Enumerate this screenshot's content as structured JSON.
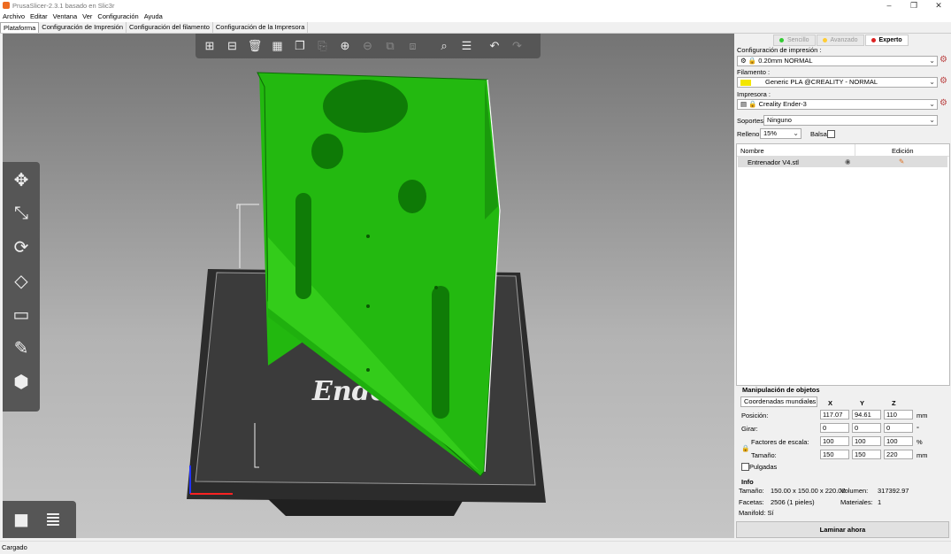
{
  "window": {
    "title": "PrusaSlicer-2.3.1 basado en Slic3r"
  },
  "menu": [
    "Archivo",
    "Editar",
    "Ventana",
    "Ver",
    "Configuración",
    "Ayuda"
  ],
  "tabs": [
    "Plataforma",
    "Configuración de Impresión",
    "Configuración del filamento",
    "Configuración de la Impresora"
  ],
  "toolbar_icons": [
    "add-icon",
    "delete-icon",
    "delete-all-icon",
    "arrange-icon",
    "copy-icon",
    "paste-icon",
    "add-instance-icon",
    "remove-instance-icon",
    "split-objects-icon",
    "split-parts-icon",
    "search-icon",
    "layers-editing-icon",
    "undo-icon",
    "redo-icon"
  ],
  "gizmo_icons": [
    "move-icon",
    "scale-icon",
    "rotate-icon",
    "place-on-face-icon",
    "cut-icon",
    "support-paint-icon",
    "seam-paint-icon"
  ],
  "view_buttons": [
    "3d-view-icon",
    "preview-layers-icon"
  ],
  "bed_label": "Ender",
  "mode": {
    "simple": "Sencillo",
    "advanced": "Avanzado",
    "expert": "Experto"
  },
  "print_settings": {
    "label": "Configuración de impresión :",
    "value": "0.20mm NORMAL"
  },
  "filament": {
    "label": "Filamento :",
    "value": "Generic PLA @CREALITY - NORMAL",
    "color": "#f3e600"
  },
  "printer": {
    "label": "Impresora :",
    "value": "Creality Ender-3"
  },
  "supports": {
    "label": "Soportes:",
    "value": "Ninguno"
  },
  "infill": {
    "label": "Relleno:",
    "value": "15%"
  },
  "brim": {
    "label": "Balsa:"
  },
  "object_list": {
    "col_name": "Nombre",
    "col_edit": "Edición",
    "item": "Entrenador V4.stl"
  },
  "manipulation": {
    "title": "Manipulación de objetos",
    "coords": "Coordenadas mundiales",
    "x": "X",
    "y": "Y",
    "z": "Z",
    "position_label": "Posición:",
    "position": [
      "117.07",
      "94.61",
      "110"
    ],
    "position_unit": "mm",
    "rotation_label": "Girar:",
    "rotation": [
      "0",
      "0",
      "0"
    ],
    "rotation_unit": "°",
    "scale_label": "Factores de escala:",
    "scale": [
      "100",
      "100",
      "100"
    ],
    "scale_unit": "%",
    "size_label": "Tamaño:",
    "size": [
      "150",
      "150",
      "220"
    ],
    "size_unit": "mm",
    "inches_label": "Pulgadas"
  },
  "info": {
    "title": "Info",
    "size_label": "Tamaño:",
    "size": "150.00 x 150.00 x 220.00",
    "volume_label": "Volumen:",
    "volume": "317392.97",
    "facets_label": "Facetas:",
    "facets": "2506 (1 pieles)",
    "materials_label": "Materiales:",
    "materials": "1",
    "manifold": "Manifold: Sí"
  },
  "slice_button": "Laminar ahora",
  "status": "Cargado"
}
